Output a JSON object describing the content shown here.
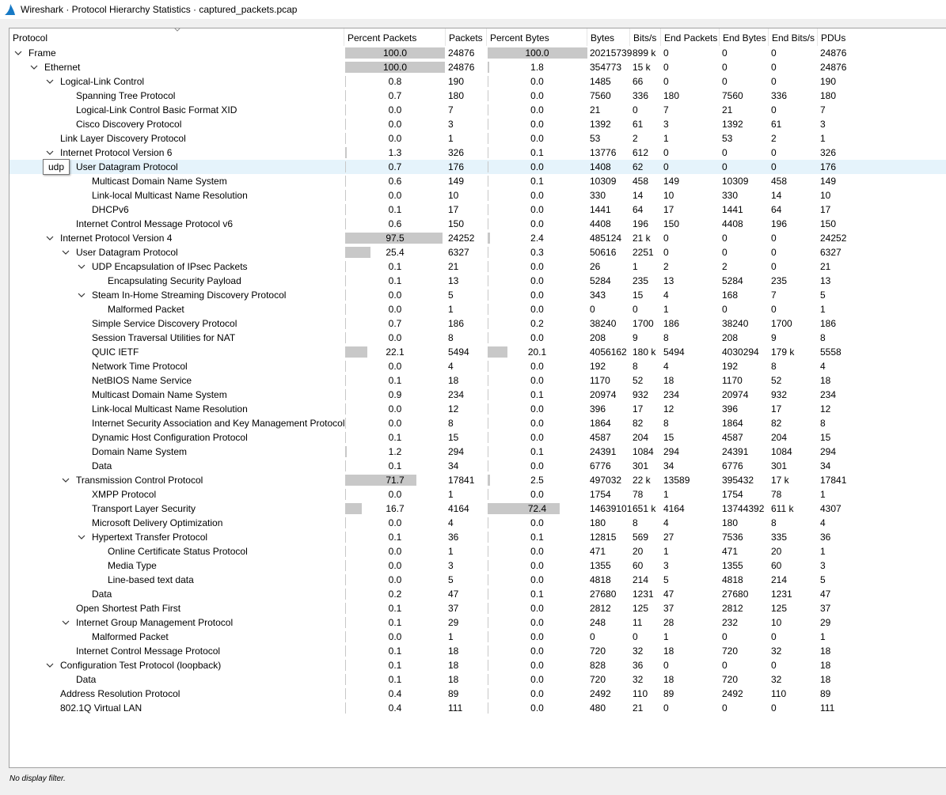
{
  "window": {
    "title": "Wireshark · Protocol Hierarchy Statistics · captured_packets.pcap"
  },
  "header": {
    "columns": [
      "Protocol",
      "Percent Packets",
      "Packets",
      "Percent Bytes",
      "Bytes",
      "Bits/s",
      "End Packets",
      "End Bytes",
      "End Bits/s",
      "PDUs"
    ]
  },
  "tooltip": {
    "text": "udp"
  },
  "status": {
    "text": "No display filter."
  },
  "rows": [
    {
      "name": "Frame",
      "depth": 0,
      "expand": true,
      "pp": "100.0",
      "pkts": "24876",
      "pb": "100.0",
      "bytes": "20215739",
      "bps": "899 k",
      "ep": "0",
      "eb": "0",
      "ebps": "0",
      "pdus": "24876"
    },
    {
      "name": "Ethernet",
      "depth": 1,
      "expand": true,
      "pp": "100.0",
      "pkts": "24876",
      "pb": "1.8",
      "bytes": "354773",
      "bps": "15 k",
      "ep": "0",
      "eb": "0",
      "ebps": "0",
      "pdus": "24876"
    },
    {
      "name": "Logical-Link Control",
      "depth": 2,
      "expand": true,
      "pp": "0.8",
      "pkts": "190",
      "pb": "0.0",
      "bytes": "1485",
      "bps": "66",
      "ep": "0",
      "eb": "0",
      "ebps": "0",
      "pdus": "190"
    },
    {
      "name": "Spanning Tree Protocol",
      "depth": 3,
      "expand": false,
      "pp": "0.7",
      "pkts": "180",
      "pb": "0.0",
      "bytes": "7560",
      "bps": "336",
      "ep": "180",
      "eb": "7560",
      "ebps": "336",
      "pdus": "180"
    },
    {
      "name": "Logical-Link Control Basic Format XID",
      "depth": 3,
      "expand": false,
      "pp": "0.0",
      "pkts": "7",
      "pb": "0.0",
      "bytes": "21",
      "bps": "0",
      "ep": "7",
      "eb": "21",
      "ebps": "0",
      "pdus": "7"
    },
    {
      "name": "Cisco Discovery Protocol",
      "depth": 3,
      "expand": false,
      "pp": "0.0",
      "pkts": "3",
      "pb": "0.0",
      "bytes": "1392",
      "bps": "61",
      "ep": "3",
      "eb": "1392",
      "ebps": "61",
      "pdus": "3"
    },
    {
      "name": "Link Layer Discovery Protocol",
      "depth": 2,
      "expand": false,
      "pp": "0.0",
      "pkts": "1",
      "pb": "0.0",
      "bytes": "53",
      "bps": "2",
      "ep": "1",
      "eb": "53",
      "ebps": "2",
      "pdus": "1"
    },
    {
      "name": "Internet Protocol Version 6",
      "depth": 2,
      "expand": true,
      "pp": "1.3",
      "pkts": "326",
      "pb": "0.1",
      "bytes": "13776",
      "bps": "612",
      "ep": "0",
      "eb": "0",
      "ebps": "0",
      "pdus": "326"
    },
    {
      "name": "User Datagram Protocol",
      "depth": 3,
      "expand": true,
      "selected": true,
      "pp": "0.7",
      "pkts": "176",
      "pb": "0.0",
      "bytes": "1408",
      "bps": "62",
      "ep": "0",
      "eb": "0",
      "ebps": "0",
      "pdus": "176"
    },
    {
      "name": "Multicast Domain Name System",
      "depth": 4,
      "expand": false,
      "pp": "0.6",
      "pkts": "149",
      "pb": "0.1",
      "bytes": "10309",
      "bps": "458",
      "ep": "149",
      "eb": "10309",
      "ebps": "458",
      "pdus": "149"
    },
    {
      "name": "Link-local Multicast Name Resolution",
      "depth": 4,
      "expand": false,
      "pp": "0.0",
      "pkts": "10",
      "pb": "0.0",
      "bytes": "330",
      "bps": "14",
      "ep": "10",
      "eb": "330",
      "ebps": "14",
      "pdus": "10"
    },
    {
      "name": "DHCPv6",
      "depth": 4,
      "expand": false,
      "pp": "0.1",
      "pkts": "17",
      "pb": "0.0",
      "bytes": "1441",
      "bps": "64",
      "ep": "17",
      "eb": "1441",
      "ebps": "64",
      "pdus": "17"
    },
    {
      "name": "Internet Control Message Protocol v6",
      "depth": 3,
      "expand": false,
      "pp": "0.6",
      "pkts": "150",
      "pb": "0.0",
      "bytes": "4408",
      "bps": "196",
      "ep": "150",
      "eb": "4408",
      "ebps": "196",
      "pdus": "150"
    },
    {
      "name": "Internet Protocol Version 4",
      "depth": 2,
      "expand": true,
      "pp": "97.5",
      "pkts": "24252",
      "pb": "2.4",
      "bytes": "485124",
      "bps": "21 k",
      "ep": "0",
      "eb": "0",
      "ebps": "0",
      "pdus": "24252"
    },
    {
      "name": "User Datagram Protocol",
      "depth": 3,
      "expand": true,
      "pp": "25.4",
      "pkts": "6327",
      "pb": "0.3",
      "bytes": "50616",
      "bps": "2251",
      "ep": "0",
      "eb": "0",
      "ebps": "0",
      "pdus": "6327"
    },
    {
      "name": "UDP Encapsulation of IPsec Packets",
      "depth": 4,
      "expand": true,
      "pp": "0.1",
      "pkts": "21",
      "pb": "0.0",
      "bytes": "26",
      "bps": "1",
      "ep": "2",
      "eb": "2",
      "ebps": "0",
      "pdus": "21"
    },
    {
      "name": "Encapsulating Security Payload",
      "depth": 5,
      "expand": false,
      "pp": "0.1",
      "pkts": "13",
      "pb": "0.0",
      "bytes": "5284",
      "bps": "235",
      "ep": "13",
      "eb": "5284",
      "ebps": "235",
      "pdus": "13"
    },
    {
      "name": "Steam In-Home Streaming Discovery Protocol",
      "depth": 4,
      "expand": true,
      "pp": "0.0",
      "pkts": "5",
      "pb": "0.0",
      "bytes": "343",
      "bps": "15",
      "ep": "4",
      "eb": "168",
      "ebps": "7",
      "pdus": "5"
    },
    {
      "name": "Malformed Packet",
      "depth": 5,
      "expand": false,
      "pp": "0.0",
      "pkts": "1",
      "pb": "0.0",
      "bytes": "0",
      "bps": "0",
      "ep": "1",
      "eb": "0",
      "ebps": "0",
      "pdus": "1"
    },
    {
      "name": "Simple Service Discovery Protocol",
      "depth": 4,
      "expand": false,
      "pp": "0.7",
      "pkts": "186",
      "pb": "0.2",
      "bytes": "38240",
      "bps": "1700",
      "ep": "186",
      "eb": "38240",
      "ebps": "1700",
      "pdus": "186"
    },
    {
      "name": "Session Traversal Utilities for NAT",
      "depth": 4,
      "expand": false,
      "pp": "0.0",
      "pkts": "8",
      "pb": "0.0",
      "bytes": "208",
      "bps": "9",
      "ep": "8",
      "eb": "208",
      "ebps": "9",
      "pdus": "8"
    },
    {
      "name": "QUIC IETF",
      "depth": 4,
      "expand": false,
      "pp": "22.1",
      "pkts": "5494",
      "pb": "20.1",
      "bytes": "4056162",
      "bps": "180 k",
      "ep": "5494",
      "eb": "4030294",
      "ebps": "179 k",
      "pdus": "5558"
    },
    {
      "name": "Network Time Protocol",
      "depth": 4,
      "expand": false,
      "pp": "0.0",
      "pkts": "4",
      "pb": "0.0",
      "bytes": "192",
      "bps": "8",
      "ep": "4",
      "eb": "192",
      "ebps": "8",
      "pdus": "4"
    },
    {
      "name": "NetBIOS Name Service",
      "depth": 4,
      "expand": false,
      "pp": "0.1",
      "pkts": "18",
      "pb": "0.0",
      "bytes": "1170",
      "bps": "52",
      "ep": "18",
      "eb": "1170",
      "ebps": "52",
      "pdus": "18"
    },
    {
      "name": "Multicast Domain Name System",
      "depth": 4,
      "expand": false,
      "pp": "0.9",
      "pkts": "234",
      "pb": "0.1",
      "bytes": "20974",
      "bps": "932",
      "ep": "234",
      "eb": "20974",
      "ebps": "932",
      "pdus": "234"
    },
    {
      "name": "Link-local Multicast Name Resolution",
      "depth": 4,
      "expand": false,
      "pp": "0.0",
      "pkts": "12",
      "pb": "0.0",
      "bytes": "396",
      "bps": "17",
      "ep": "12",
      "eb": "396",
      "ebps": "17",
      "pdus": "12"
    },
    {
      "name": "Internet Security Association and Key Management Protocol",
      "depth": 4,
      "expand": false,
      "pp": "0.0",
      "pkts": "8",
      "pb": "0.0",
      "bytes": "1864",
      "bps": "82",
      "ep": "8",
      "eb": "1864",
      "ebps": "82",
      "pdus": "8"
    },
    {
      "name": "Dynamic Host Configuration Protocol",
      "depth": 4,
      "expand": false,
      "pp": "0.1",
      "pkts": "15",
      "pb": "0.0",
      "bytes": "4587",
      "bps": "204",
      "ep": "15",
      "eb": "4587",
      "ebps": "204",
      "pdus": "15"
    },
    {
      "name": "Domain Name System",
      "depth": 4,
      "expand": false,
      "pp": "1.2",
      "pkts": "294",
      "pb": "0.1",
      "bytes": "24391",
      "bps": "1084",
      "ep": "294",
      "eb": "24391",
      "ebps": "1084",
      "pdus": "294"
    },
    {
      "name": "Data",
      "depth": 4,
      "expand": false,
      "pp": "0.1",
      "pkts": "34",
      "pb": "0.0",
      "bytes": "6776",
      "bps": "301",
      "ep": "34",
      "eb": "6776",
      "ebps": "301",
      "pdus": "34"
    },
    {
      "name": "Transmission Control Protocol",
      "depth": 3,
      "expand": true,
      "pp": "71.7",
      "pkts": "17841",
      "pb": "2.5",
      "bytes": "497032",
      "bps": "22 k",
      "ep": "13589",
      "eb": "395432",
      "ebps": "17 k",
      "pdus": "17841"
    },
    {
      "name": "XMPP Protocol",
      "depth": 4,
      "expand": false,
      "pp": "0.0",
      "pkts": "1",
      "pb": "0.0",
      "bytes": "1754",
      "bps": "78",
      "ep": "1",
      "eb": "1754",
      "ebps": "78",
      "pdus": "1"
    },
    {
      "name": "Transport Layer Security",
      "depth": 4,
      "expand": false,
      "pp": "16.7",
      "pkts": "4164",
      "pb": "72.4",
      "bytes": "14639101",
      "bps": "651 k",
      "ep": "4164",
      "eb": "13744392",
      "ebps": "611 k",
      "pdus": "4307"
    },
    {
      "name": "Microsoft Delivery Optimization",
      "depth": 4,
      "expand": false,
      "pp": "0.0",
      "pkts": "4",
      "pb": "0.0",
      "bytes": "180",
      "bps": "8",
      "ep": "4",
      "eb": "180",
      "ebps": "8",
      "pdus": "4"
    },
    {
      "name": "Hypertext Transfer Protocol",
      "depth": 4,
      "expand": true,
      "pp": "0.1",
      "pkts": "36",
      "pb": "0.1",
      "bytes": "12815",
      "bps": "569",
      "ep": "27",
      "eb": "7536",
      "ebps": "335",
      "pdus": "36"
    },
    {
      "name": "Online Certificate Status Protocol",
      "depth": 5,
      "expand": false,
      "pp": "0.0",
      "pkts": "1",
      "pb": "0.0",
      "bytes": "471",
      "bps": "20",
      "ep": "1",
      "eb": "471",
      "ebps": "20",
      "pdus": "1"
    },
    {
      "name": "Media Type",
      "depth": 5,
      "expand": false,
      "pp": "0.0",
      "pkts": "3",
      "pb": "0.0",
      "bytes": "1355",
      "bps": "60",
      "ep": "3",
      "eb": "1355",
      "ebps": "60",
      "pdus": "3"
    },
    {
      "name": "Line-based text data",
      "depth": 5,
      "expand": false,
      "pp": "0.0",
      "pkts": "5",
      "pb": "0.0",
      "bytes": "4818",
      "bps": "214",
      "ep": "5",
      "eb": "4818",
      "ebps": "214",
      "pdus": "5"
    },
    {
      "name": "Data",
      "depth": 4,
      "expand": false,
      "pp": "0.2",
      "pkts": "47",
      "pb": "0.1",
      "bytes": "27680",
      "bps": "1231",
      "ep": "47",
      "eb": "27680",
      "ebps": "1231",
      "pdus": "47"
    },
    {
      "name": "Open Shortest Path First",
      "depth": 3,
      "expand": false,
      "pp": "0.1",
      "pkts": "37",
      "pb": "0.0",
      "bytes": "2812",
      "bps": "125",
      "ep": "37",
      "eb": "2812",
      "ebps": "125",
      "pdus": "37"
    },
    {
      "name": "Internet Group Management Protocol",
      "depth": 3,
      "expand": true,
      "pp": "0.1",
      "pkts": "29",
      "pb": "0.0",
      "bytes": "248",
      "bps": "11",
      "ep": "28",
      "eb": "232",
      "ebps": "10",
      "pdus": "29"
    },
    {
      "name": "Malformed Packet",
      "depth": 4,
      "expand": false,
      "pp": "0.0",
      "pkts": "1",
      "pb": "0.0",
      "bytes": "0",
      "bps": "0",
      "ep": "1",
      "eb": "0",
      "ebps": "0",
      "pdus": "1"
    },
    {
      "name": "Internet Control Message Protocol",
      "depth": 3,
      "expand": false,
      "pp": "0.1",
      "pkts": "18",
      "pb": "0.0",
      "bytes": "720",
      "bps": "32",
      "ep": "18",
      "eb": "720",
      "ebps": "32",
      "pdus": "18"
    },
    {
      "name": "Configuration Test Protocol (loopback)",
      "depth": 2,
      "expand": true,
      "pp": "0.1",
      "pkts": "18",
      "pb": "0.0",
      "bytes": "828",
      "bps": "36",
      "ep": "0",
      "eb": "0",
      "ebps": "0",
      "pdus": "18"
    },
    {
      "name": "Data",
      "depth": 3,
      "expand": false,
      "pp": "0.1",
      "pkts": "18",
      "pb": "0.0",
      "bytes": "720",
      "bps": "32",
      "ep": "18",
      "eb": "720",
      "ebps": "32",
      "pdus": "18"
    },
    {
      "name": "Address Resolution Protocol",
      "depth": 2,
      "expand": false,
      "pp": "0.4",
      "pkts": "89",
      "pb": "0.0",
      "bytes": "2492",
      "bps": "110",
      "ep": "89",
      "eb": "2492",
      "ebps": "110",
      "pdus": "89"
    },
    {
      "name": "802.1Q Virtual LAN",
      "depth": 2,
      "expand": false,
      "pp": "0.4",
      "pkts": "111",
      "pb": "0.0",
      "bytes": "480",
      "bps": "21",
      "ep": "0",
      "eb": "0",
      "ebps": "0",
      "pdus": "111"
    }
  ]
}
